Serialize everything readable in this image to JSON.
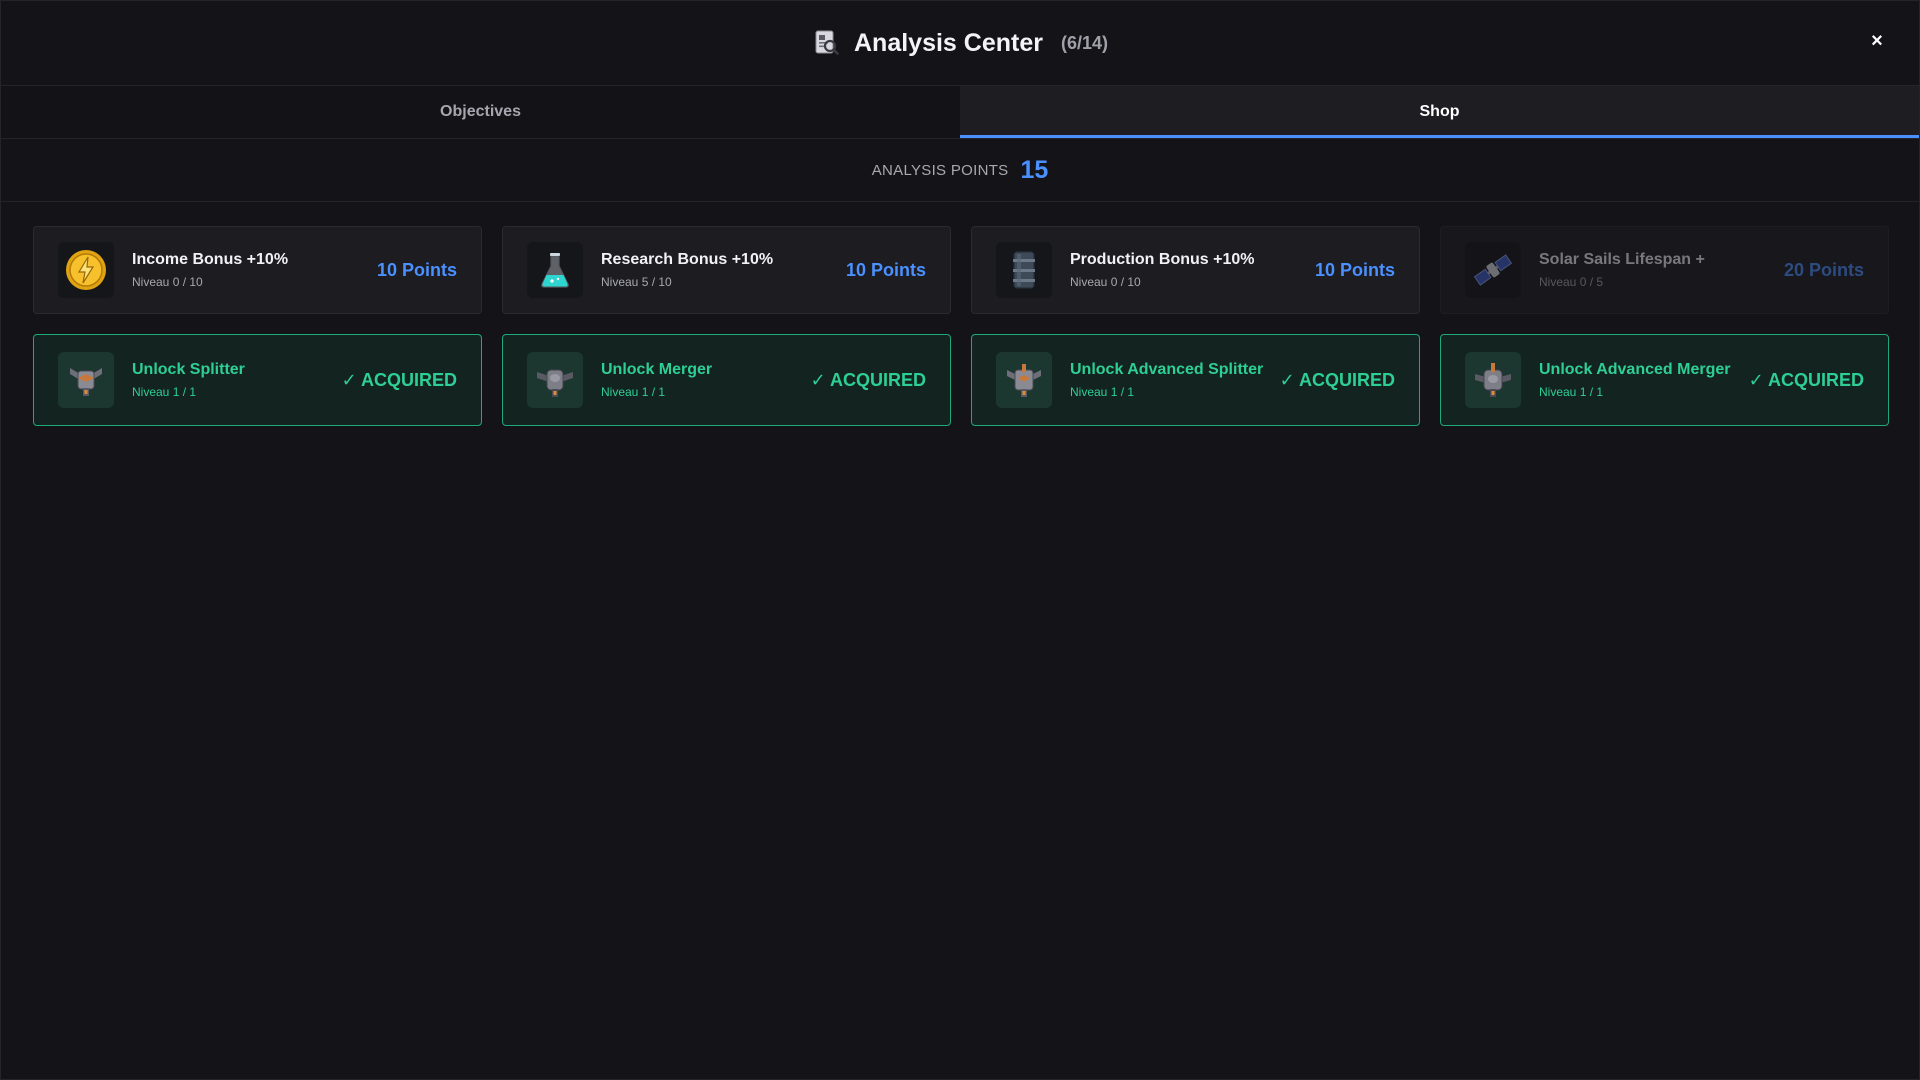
{
  "header": {
    "title": "Analysis Center",
    "count": "(6/14)",
    "icon": "analysis-report-icon",
    "close_label": "×"
  },
  "tabs": [
    {
      "label": "Objectives",
      "active": false
    },
    {
      "label": "Shop",
      "active": true
    }
  ],
  "points": {
    "label": "ANALYSIS POINTS",
    "value": "15"
  },
  "colors": {
    "accent": "#4a90ff",
    "acquired": "#2ecf95",
    "background": "#141418"
  },
  "shop_items": [
    {
      "name": "Income Bonus +10%",
      "level": "Niveau 0 / 10",
      "cost": "10 Points",
      "icon": "gold-coin-lightning-icon"
    },
    {
      "name": "Research Bonus +10%",
      "level": "Niveau 5 / 10",
      "cost": "10 Points",
      "icon": "flask-icon"
    },
    {
      "name": "Production Bonus +10%",
      "level": "Niveau 0 / 10",
      "cost": "10 Points",
      "icon": "barrel-icon"
    },
    {
      "name": "Solar Sails Lifespan +",
      "level": "Niveau 0 / 5",
      "cost": "20 Points",
      "icon": "satellite-icon"
    }
  ],
  "unlocks": [
    {
      "name": "Unlock Splitter",
      "level": "Niveau 1 / 1",
      "status": "✓ ACQUIRED",
      "icon": "splitter-icon"
    },
    {
      "name": "Unlock Merger",
      "level": "Niveau 1 / 1",
      "status": "✓ ACQUIRED",
      "icon": "merger-icon"
    },
    {
      "name": "Unlock Advanced Splitter",
      "level": "Niveau 1 / 1",
      "status": "✓ ACQUIRED",
      "icon": "advanced-splitter-icon"
    },
    {
      "name": "Unlock Advanced Merger",
      "level": "Niveau 1 / 1",
      "status": "✓ ACQUIRED",
      "icon": "advanced-merger-icon"
    }
  ]
}
